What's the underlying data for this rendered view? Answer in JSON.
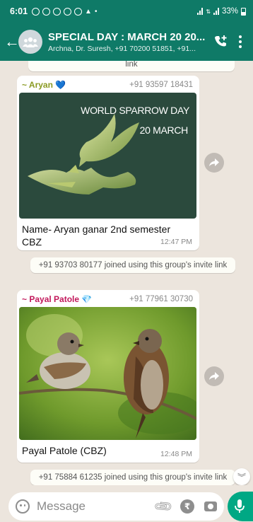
{
  "status_bar": {
    "time": "6:01",
    "battery": "33%"
  },
  "header": {
    "title": "SPECIAL DAY : MARCH 20 20...",
    "subtitle": "Archna, Dr. Suresh, +91 70200 51851, +91..."
  },
  "messages": {
    "top_system_fragment": "link",
    "aryan": {
      "sender": "~ Aryan 💙",
      "phone": "+91 93597 18431",
      "poster_title": "WORLD SPARROW DAY",
      "poster_date": "20 MARCH",
      "caption": "Name- Aryan ganar  2nd semester CBZ",
      "time": "12:47 PM"
    },
    "join_1": "+91 93703 80177 joined using this group's invite link",
    "payal": {
      "sender": "~ Payal Patole 💎",
      "phone": "+91 77961 30730",
      "caption": "Payal Patole  (CBZ)",
      "time": "12:48 PM"
    },
    "join_2": "+91 75884 61235 joined using this group's invite link"
  },
  "composer": {
    "placeholder": "Message"
  },
  "colors": {
    "header_green": "#0f7a67",
    "chat_background": "#ece5dd",
    "aryan_name": "#8a9a22",
    "payal_name": "#c2185b",
    "send_green": "#00a884",
    "poster_green": "#2b4a3d"
  }
}
